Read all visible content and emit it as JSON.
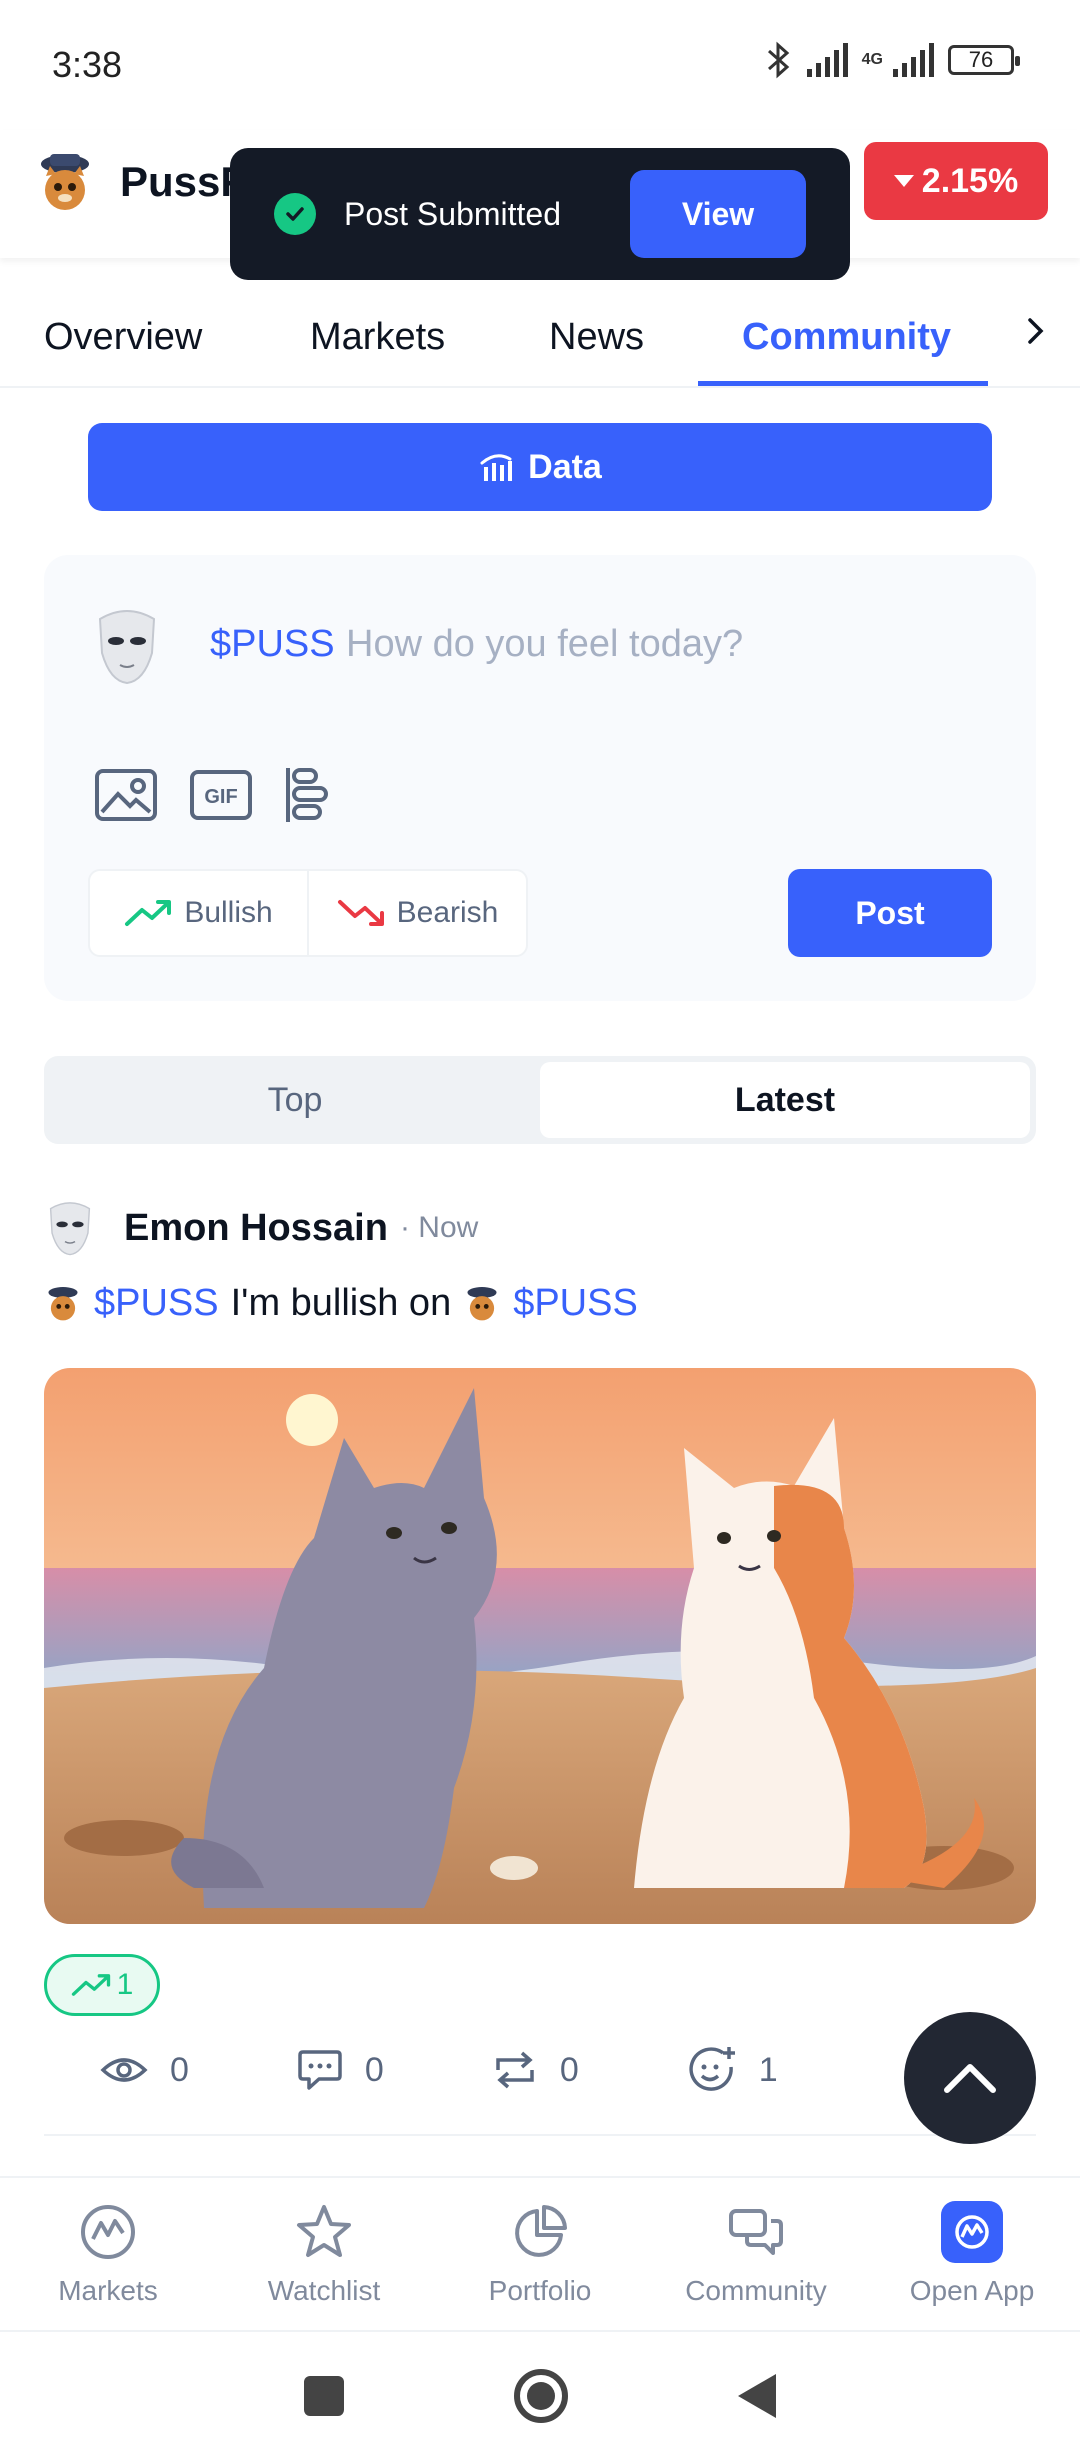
{
  "status_bar": {
    "time": "3:38",
    "battery": "76",
    "network": "4G"
  },
  "header": {
    "coin_name": "PussF",
    "change": "2.15%",
    "change_color": "#ea3943"
  },
  "toast": {
    "message": "Post Submitted",
    "action": "View"
  },
  "tabs": [
    {
      "label": "Overview",
      "active": false
    },
    {
      "label": "Markets",
      "active": false
    },
    {
      "label": "News",
      "active": false
    },
    {
      "label": "Community",
      "active": true
    }
  ],
  "data_button": {
    "label": "Data"
  },
  "composer": {
    "ticker": "$PUSS",
    "placeholder": "How do you feel today?",
    "bullish_label": "Bullish",
    "bearish_label": "Bearish",
    "post_label": "Post"
  },
  "feed_toggle": {
    "top": "Top",
    "latest": "Latest",
    "selected": "Latest"
  },
  "post": {
    "author": "Emon Hossain",
    "time": "· Now",
    "ticker1": "$PUSS",
    "text": "I'm bullish on",
    "ticker2": "$PUSS",
    "bullish_count": "1",
    "views": "0",
    "comments": "0",
    "reposts": "0",
    "reactions": "1"
  },
  "bottom_nav": [
    {
      "label": "Markets",
      "icon": "markets-icon"
    },
    {
      "label": "Watchlist",
      "icon": "star-icon"
    },
    {
      "label": "Portfolio",
      "icon": "pie-chart-icon"
    },
    {
      "label": "Community",
      "icon": "chat-icon"
    },
    {
      "label": "Open App",
      "icon": "open-app-icon"
    }
  ],
  "colors": {
    "accent": "#3861fb",
    "positive": "#16c784",
    "negative": "#ea3943"
  }
}
